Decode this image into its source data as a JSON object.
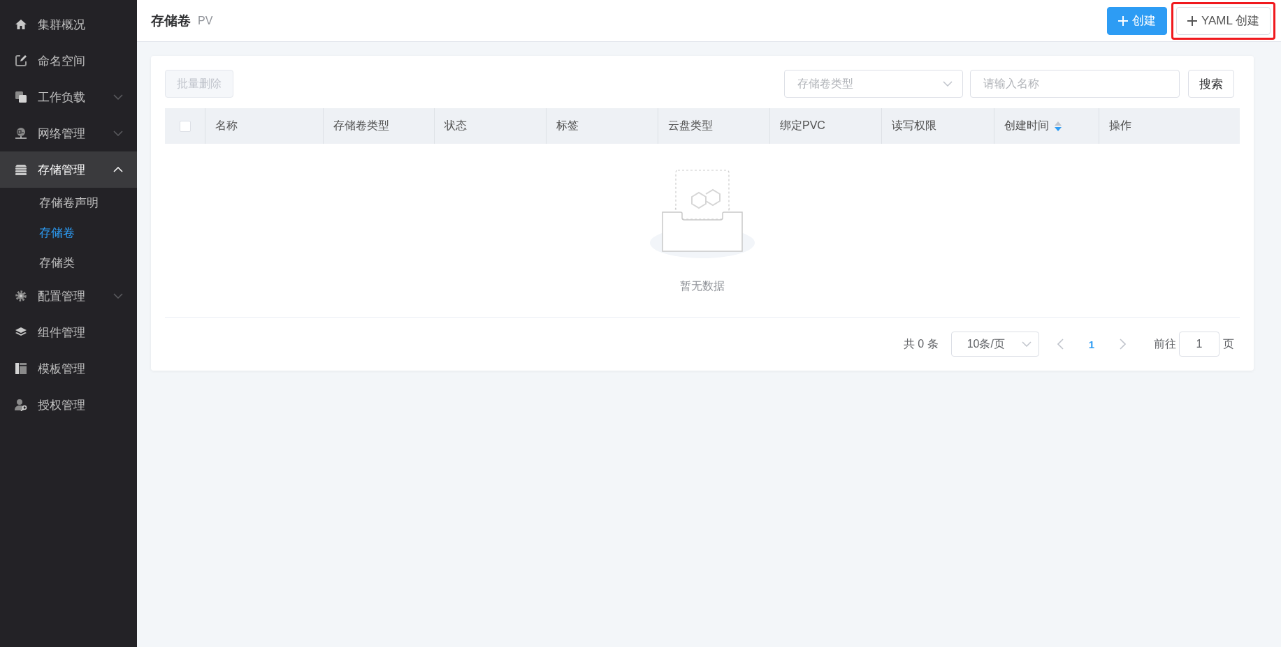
{
  "sidebar": {
    "items": [
      {
        "label": "集群概况",
        "selected": false
      },
      {
        "label": "命名空间",
        "selected": false
      },
      {
        "label": "工作负载",
        "selected": false,
        "expanded": false
      },
      {
        "label": "网络管理",
        "selected": false,
        "expanded": false
      },
      {
        "label": "存储管理",
        "selected": true,
        "expanded": true,
        "children": [
          {
            "label": "存储卷声明",
            "selected": false
          },
          {
            "label": "存储卷",
            "selected": true
          },
          {
            "label": "存储类",
            "selected": false
          }
        ]
      },
      {
        "label": "配置管理",
        "selected": false,
        "expanded": false
      },
      {
        "label": "组件管理",
        "selected": false
      },
      {
        "label": "模板管理",
        "selected": false
      },
      {
        "label": "授权管理",
        "selected": false
      }
    ]
  },
  "header": {
    "title": "存储卷",
    "subtitle": "PV",
    "buttons": [
      {
        "label": "创建",
        "kind": "primary",
        "highlighted": false
      },
      {
        "label": "YAML 创建",
        "kind": "default",
        "highlighted": true
      }
    ]
  },
  "toolbar": {
    "bulk_delete": {
      "label": "批量删除",
      "disabled": true
    },
    "type_select": {
      "placeholder": "存储卷类型"
    },
    "name_search": {
      "placeholder": "请输入名称"
    },
    "search_button": "搜索"
  },
  "table": {
    "select_all": {
      "checked": false
    },
    "columns": [
      {
        "label": "名称"
      },
      {
        "label": "存储卷类型"
      },
      {
        "label": "状态"
      },
      {
        "label": "标签"
      },
      {
        "label": "云盘类型"
      },
      {
        "label": "绑定PVC"
      },
      {
        "label": "读写权限"
      },
      {
        "label": "创建时间",
        "sorted_descending": true
      },
      {
        "label": "操作"
      }
    ],
    "empty_text": "暂无数据"
  },
  "pagination": {
    "total": "共 0 条",
    "page_size": "10条/页",
    "pages": [
      {
        "label": "1",
        "selected": true
      }
    ],
    "goto_label": "前往",
    "goto_value": "1",
    "page_unit": "页"
  }
}
